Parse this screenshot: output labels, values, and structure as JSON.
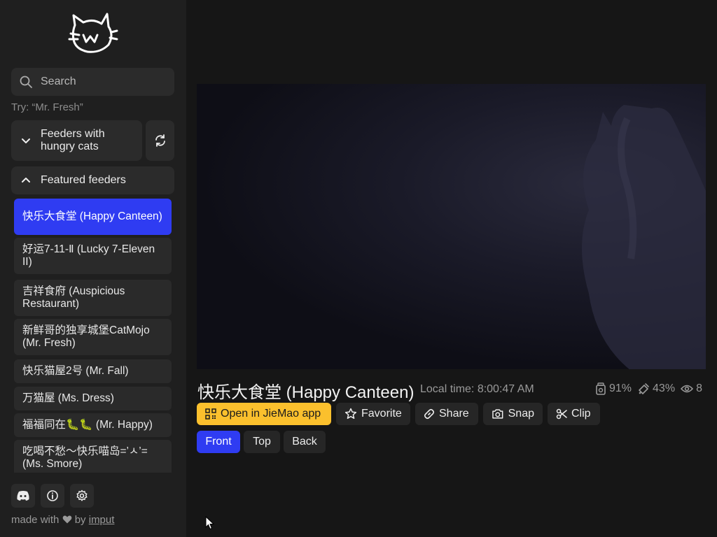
{
  "sidebar": {
    "search": {
      "placeholder": "Search",
      "value": ""
    },
    "try_hint": "Try: “Mr. Fresh”",
    "hungry_label": "Feeders with hungry cats",
    "featured_label": "Featured feeders",
    "items": [
      {
        "label": "快乐大食堂 (Happy Canteen)",
        "active": true
      },
      {
        "label": "好运7-11-Ⅱ (Lucky 7-Eleven II)",
        "active": false
      },
      {
        "label": "吉祥食府 (Auspicious Restaurant)",
        "active": false
      },
      {
        "label": "新鲜哥的独享城堡CatMojo (Mr. Fresh)",
        "active": false
      },
      {
        "label": "快乐猫屋2号 (Mr. Fall)",
        "active": false
      },
      {
        "label": "万猫屋 (Ms. Dress)",
        "active": false
      },
      {
        "label": "福福同在🐛🐛 (Mr. Happy)",
        "active": false
      },
      {
        "label": "吃喝不愁～快乐喵岛=’ㅅ’= (Ms. Smore)",
        "active": false
      }
    ],
    "footer": {
      "made_prefix": "made with",
      "by": "by",
      "author": "imput"
    }
  },
  "main": {
    "feeder_title": "快乐大食堂 (Happy Canteen)",
    "local_time": "Local time: 8:00:47 AM",
    "stats": {
      "food": "91%",
      "battery": "43%",
      "viewers": "8"
    },
    "actions": {
      "open_app": "Open in JieMao app",
      "favorite": "Favorite",
      "share": "Share",
      "snap": "Snap",
      "clip": "Clip"
    },
    "views": [
      {
        "label": "Front",
        "active": true
      },
      {
        "label": "Top",
        "active": false
      },
      {
        "label": "Back",
        "active": false
      }
    ]
  },
  "colors": {
    "accent": "#2f3cf2",
    "app_button": "#fbc02d",
    "sidebar_bg": "#1f1f1f",
    "page_bg": "#161616"
  }
}
